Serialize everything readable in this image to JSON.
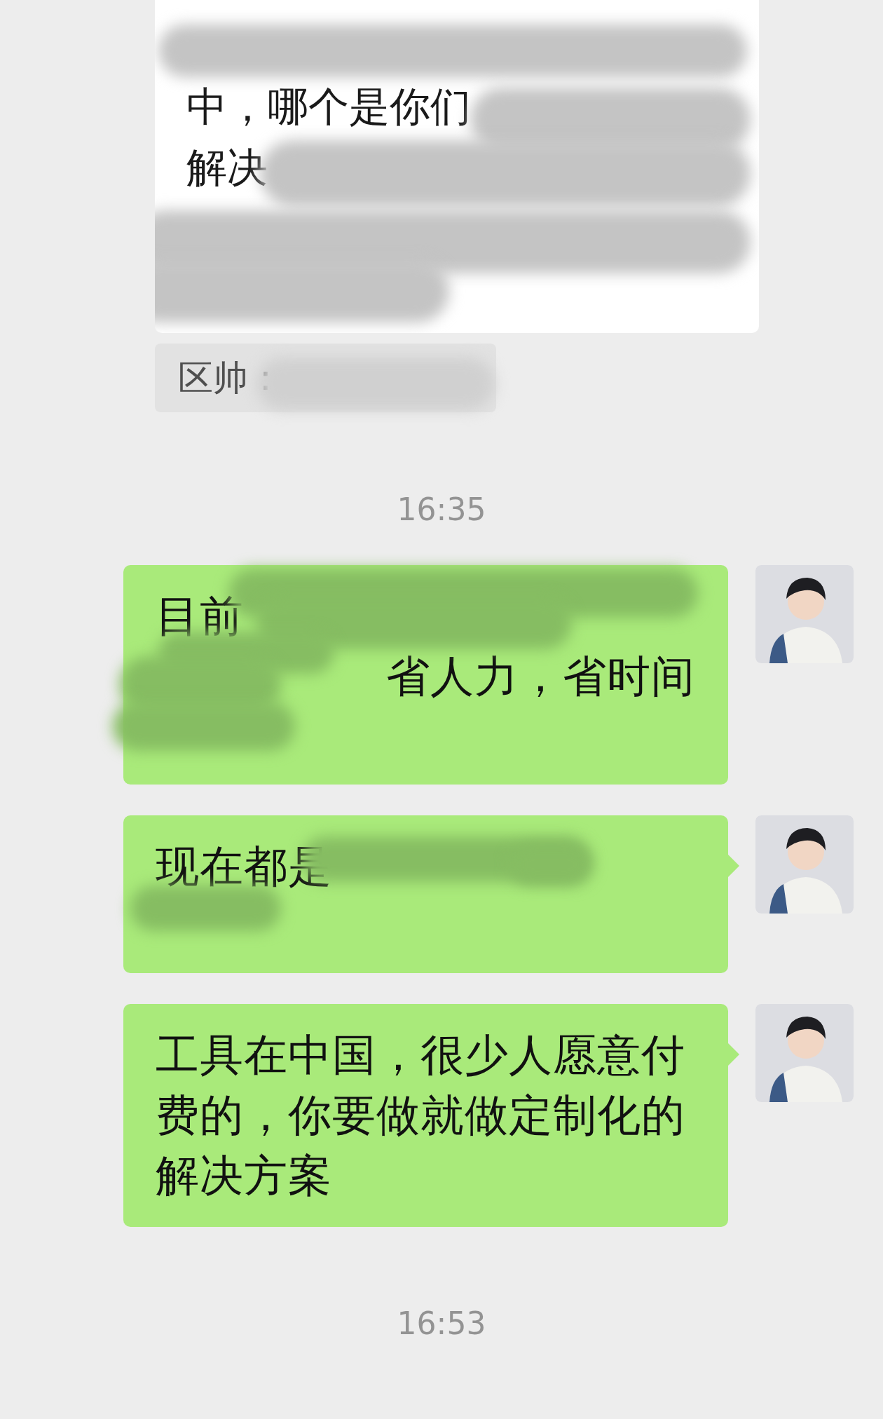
{
  "incoming_card": {
    "lines": [
      "中，哪个是你们",
      "解决"
    ],
    "redacted": true
  },
  "quote": {
    "text": "区帅：",
    "redacted": true
  },
  "timestamps": [
    "16:35",
    "16:53"
  ],
  "messages": [
    {
      "lines": [
        "目前",
        "省人力，省时间"
      ],
      "redacted": true,
      "tail": false
    },
    {
      "lines": [
        "现在都是"
      ],
      "redacted": true,
      "tail": true
    },
    {
      "lines": [
        "工具在中国，很少人愿意付费的，你要做就做定制化的解决方案"
      ],
      "tail": true
    }
  ]
}
